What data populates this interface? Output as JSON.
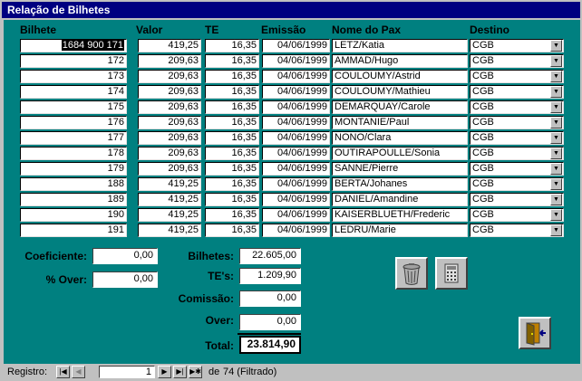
{
  "window": {
    "title": "Relação de Bilhetes"
  },
  "columns": {
    "bilhete": "Bilhete",
    "valor": "Valor",
    "te": "TE",
    "emissao": "Emissão",
    "pax": "Nome do Pax",
    "destino": "Destino"
  },
  "rows": [
    {
      "bilhete": "1684 900 171",
      "valor": "419,25",
      "te": "16,35",
      "emissao": "04/06/1999",
      "pax": "LETZ/Katia",
      "destino": "CGB"
    },
    {
      "bilhete": "172",
      "valor": "209,63",
      "te": "16,35",
      "emissao": "04/06/1999",
      "pax": "AMMAD/Hugo",
      "destino": "CGB"
    },
    {
      "bilhete": "173",
      "valor": "209,63",
      "te": "16,35",
      "emissao": "04/06/1999",
      "pax": "COULOUMY/Astrid",
      "destino": "CGB"
    },
    {
      "bilhete": "174",
      "valor": "209,63",
      "te": "16,35",
      "emissao": "04/06/1999",
      "pax": "COULOUMY/Mathieu",
      "destino": "CGB"
    },
    {
      "bilhete": "175",
      "valor": "209,63",
      "te": "16,35",
      "emissao": "04/06/1999",
      "pax": "DEMARQUAY/Carole",
      "destino": "CGB"
    },
    {
      "bilhete": "176",
      "valor": "209,63",
      "te": "16,35",
      "emissao": "04/06/1999",
      "pax": "MONTANIE/Paul",
      "destino": "CGB"
    },
    {
      "bilhete": "177",
      "valor": "209,63",
      "te": "16,35",
      "emissao": "04/06/1999",
      "pax": "NONO/Clara",
      "destino": "CGB"
    },
    {
      "bilhete": "178",
      "valor": "209,63",
      "te": "16,35",
      "emissao": "04/06/1999",
      "pax": "OUTIRAPOULLE/Sonia",
      "destino": "CGB"
    },
    {
      "bilhete": "179",
      "valor": "209,63",
      "te": "16,35",
      "emissao": "04/06/1999",
      "pax": "SANNE/Pierre",
      "destino": "CGB"
    },
    {
      "bilhete": "188",
      "valor": "419,25",
      "te": "16,35",
      "emissao": "04/06/1999",
      "pax": "BERTA/Johanes",
      "destino": "CGB"
    },
    {
      "bilhete": "189",
      "valor": "419,25",
      "te": "16,35",
      "emissao": "04/06/1999",
      "pax": "DANIEL/Amandine",
      "destino": "CGB"
    },
    {
      "bilhete": "190",
      "valor": "419,25",
      "te": "16,35",
      "emissao": "04/06/1999",
      "pax": "KAISERBLUETH/Frederic",
      "destino": "CGB"
    },
    {
      "bilhete": "191",
      "valor": "419,25",
      "te": "16,35",
      "emissao": "04/06/1999",
      "pax": "LEDRU/Marie",
      "destino": "CGB"
    }
  ],
  "summary": {
    "coeficiente_label": "Coeficiente:",
    "coeficiente_value": "0,00",
    "over_pct_label": "% Over:",
    "over_pct_value": "0,00",
    "bilhetes_label": "Bilhetes:",
    "bilhetes_value": "22.605,00",
    "tes_label": "TE's:",
    "tes_value": "1.209,90",
    "comissao_label": "Comissão:",
    "comissao_value": "0,00",
    "over_label": "Over:",
    "over_value": "0,00",
    "total_label": "Total:",
    "total_value": "23.814,90"
  },
  "icons": {
    "delete": "trash-can-icon",
    "calculator": "calculator-icon",
    "exit": "exit-door-icon"
  },
  "navigation": {
    "registro_label": "Registro:",
    "current_record": "1",
    "of_label": "de",
    "total_records": "74 (Filtrado)"
  },
  "colors": {
    "form_background": "#008080",
    "titlebar": "#000080"
  }
}
